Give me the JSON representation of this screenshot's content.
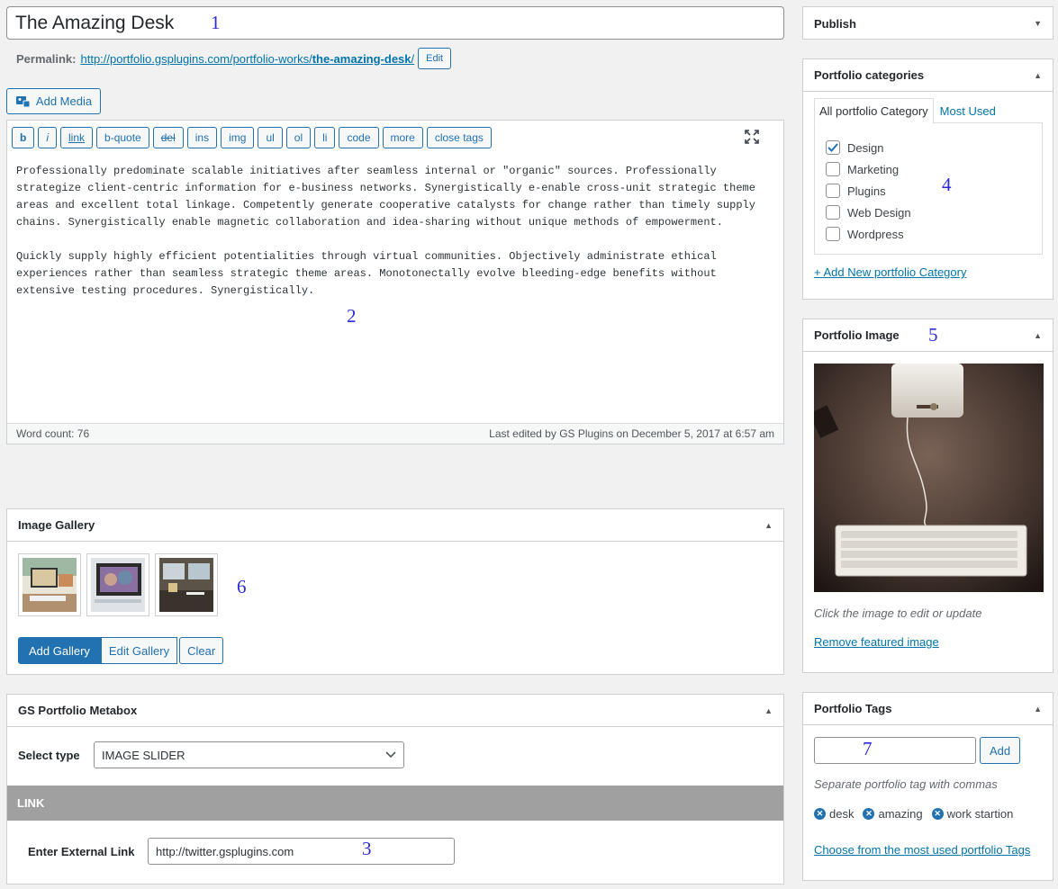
{
  "title": {
    "value": "The Amazing Desk"
  },
  "permalink": {
    "label": "Permalink:",
    "url_base": "http://portfolio.gsplugins.com/portfolio-works/",
    "slug": "the-amazing-desk",
    "url_end": "/",
    "edit_label": "Edit"
  },
  "media": {
    "add_label": "Add Media"
  },
  "editor": {
    "buttons": [
      "b",
      "i",
      "link",
      "b-quote",
      "del",
      "ins",
      "img",
      "ul",
      "ol",
      "li",
      "code",
      "more",
      "close tags"
    ],
    "content": "Professionally predominate scalable initiatives after seamless internal or \"organic\" sources. Professionally\nstrategize client-centric information for e-business networks. Synergistically e-enable cross-unit strategic theme\nareas and excellent total linkage. Competently generate cooperative catalysts for change rather than timely supply\nchains. Synergistically enable magnetic collaboration and idea-sharing without unique methods of empowerment.\n\nQuickly supply highly efficient potentialities through virtual communities. Objectively administrate ethical\nexperiences rather than seamless strategic theme areas. Monotonectally evolve bleeding-edge benefits without\nextensive testing procedures. Synergistically.",
    "word_count": "Word count: 76",
    "last_edited": "Last edited by GS Plugins on December 5, 2017 at 6:57 am"
  },
  "gallery": {
    "title": "Image Gallery",
    "add": "Add Gallery",
    "edit": "Edit Gallery",
    "clear": "Clear"
  },
  "metabox": {
    "title": "GS Portfolio Metabox",
    "select_label": "Select type",
    "select_value": "IMAGE SLIDER",
    "section": "LINK",
    "link_label": "Enter External Link",
    "link_value": "http://twitter.gsplugins.com"
  },
  "publish": {
    "title": "Publish"
  },
  "categories": {
    "title": "Portfolio categories",
    "tab_all": "All portfolio Category",
    "tab_used": "Most Used",
    "items": [
      {
        "label": "Design",
        "checked": true
      },
      {
        "label": "Marketing",
        "checked": false
      },
      {
        "label": "Plugins",
        "checked": false
      },
      {
        "label": "Web Design",
        "checked": false
      },
      {
        "label": "Wordpress",
        "checked": false
      }
    ],
    "add_new": "+ Add New portfolio Category"
  },
  "portfolio_image": {
    "title": "Portfolio Image",
    "hint": "Click the image to edit or update",
    "remove": "Remove featured image"
  },
  "tags": {
    "title": "Portfolio Tags",
    "add": "Add",
    "hint": "Separate portfolio tag with commas",
    "items": [
      "desk",
      "amazing",
      "work startion"
    ],
    "choose": "Choose from the most used portfolio Tags"
  },
  "annotations": [
    "1",
    "2",
    "3",
    "4",
    "5",
    "6",
    "7"
  ],
  "colors": {
    "primary": "#2271b1",
    "link": "#0073aa",
    "section_bg": "#a0a0a0"
  }
}
